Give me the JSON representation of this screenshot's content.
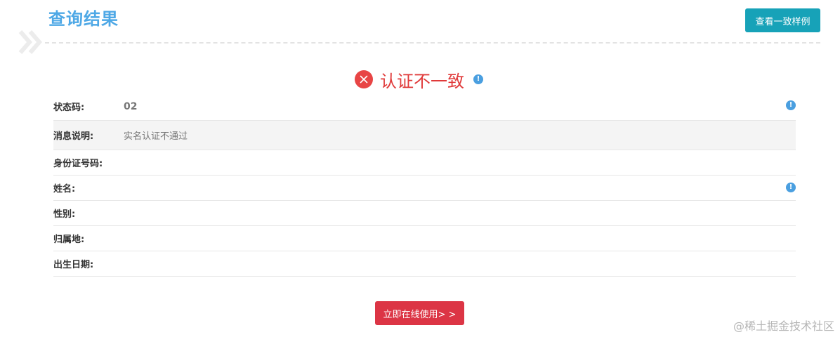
{
  "page": {
    "title": "查询结果",
    "sample_button_label": "查看一致样例",
    "use_button_label": "立即在线使用> >",
    "watermark": "@稀土掘金技术社区"
  },
  "result": {
    "status_text": "认证不一致",
    "status_color": "#e03a3a",
    "icon": "x-circle-icon",
    "info_icon": "info-icon",
    "info_glyph": "!"
  },
  "fields": [
    {
      "label": "状态码:",
      "value": "02"
    },
    {
      "label": "消息说明:",
      "value": "实名认证不通过"
    },
    {
      "label": "身份证号码:",
      "value": ""
    },
    {
      "label": "姓名:",
      "value": ""
    },
    {
      "label": "性别:",
      "value": ""
    },
    {
      "label": "归属地:",
      "value": ""
    },
    {
      "label": "出生日期:",
      "value": ""
    }
  ],
  "colors": {
    "title": "#4ea8e6",
    "sample_button_bg": "#17a2b8",
    "use_button_bg": "#dc3545",
    "info_icon": "#4a9fe0",
    "alt_row_bg": "#f4f4f4"
  }
}
